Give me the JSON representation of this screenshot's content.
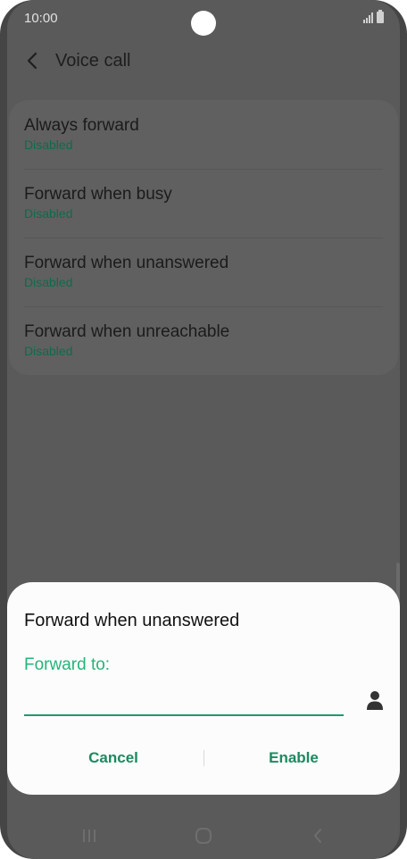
{
  "status_bar": {
    "time": "10:00",
    "icons": [
      "signal-icon",
      "battery-icon"
    ]
  },
  "header": {
    "title": "Voice call",
    "back_icon": "chevron-left-icon"
  },
  "settings": {
    "items": [
      {
        "title": "Always forward",
        "status": "Disabled"
      },
      {
        "title": "Forward when busy",
        "status": "Disabled"
      },
      {
        "title": "Forward when unanswered",
        "status": "Disabled"
      },
      {
        "title": "Forward when unreachable",
        "status": "Disabled"
      }
    ],
    "status_color": "#0f6b4a"
  },
  "dialog": {
    "title": "Forward when unanswered",
    "field_label": "Forward to:",
    "input_value": "",
    "input_placeholder": "",
    "contact_icon": "person-icon",
    "cancel_label": "Cancel",
    "enable_label": "Enable",
    "accent_color": "#26b37a"
  },
  "nav_bar": {
    "icons": [
      "recents-icon",
      "home-icon",
      "back-icon"
    ]
  }
}
